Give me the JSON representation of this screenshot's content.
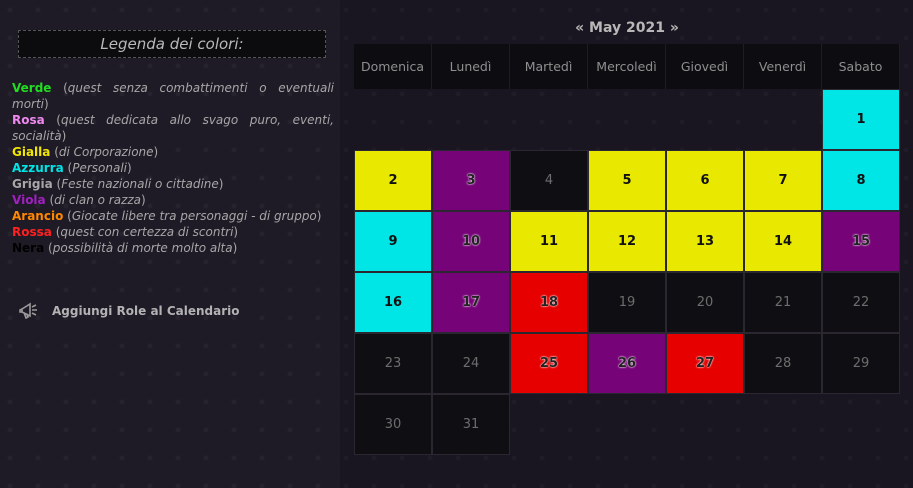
{
  "legend": {
    "title": "Legenda dei colori:",
    "items": [
      {
        "name": "Verde",
        "desc": "quest senza combattimenti o eventuali morti",
        "color": "#22dd22"
      },
      {
        "name": "Rosa",
        "desc": "quest dedicata allo svago puro, eventi, socialità",
        "color": "#ee88ee"
      },
      {
        "name": "Gialla",
        "desc": "di Corporazione",
        "color": "#f2e600"
      },
      {
        "name": "Azzurra",
        "desc": "Personali",
        "color": "#00e4e4"
      },
      {
        "name": "Grigia",
        "desc": "Feste nazionali o cittadine",
        "color": "#a7a7a7"
      },
      {
        "name": "Viola",
        "desc": "di clan o razza",
        "color": "#a020c0"
      },
      {
        "name": "Arancio",
        "desc": "Giocate libere tra personaggi - di gruppo",
        "color": "#ff8800"
      },
      {
        "name": "Rossa",
        "desc": "quest con certezza di scontri",
        "color": "#ff2020"
      },
      {
        "name": "Nera",
        "desc": "possibilità di morte molto alta",
        "color": "#000000"
      }
    ]
  },
  "add_role": {
    "label": "Aggiungi Role al Calendario",
    "icon": "megaphone-icon"
  },
  "calendar": {
    "prev": "«",
    "month_label": "May 2021",
    "next": "»",
    "weekdays": [
      "Domenica",
      "Lunedì",
      "Martedì",
      "Mercoledì",
      "Giovedì",
      "Venerdì",
      "Sabato"
    ],
    "weeks": [
      [
        {
          "day": "",
          "c": ""
        },
        {
          "day": "",
          "c": ""
        },
        {
          "day": "",
          "c": ""
        },
        {
          "day": "",
          "c": ""
        },
        {
          "day": "",
          "c": ""
        },
        {
          "day": "",
          "c": ""
        },
        {
          "day": "1",
          "c": "cyan"
        }
      ],
      [
        {
          "day": "2",
          "c": "yellow"
        },
        {
          "day": "3",
          "c": "purple"
        },
        {
          "day": "4",
          "c": "black"
        },
        {
          "day": "5",
          "c": "yellow"
        },
        {
          "day": "6",
          "c": "yellow"
        },
        {
          "day": "7",
          "c": "yellow"
        },
        {
          "day": "8",
          "c": "cyan"
        }
      ],
      [
        {
          "day": "9",
          "c": "cyan"
        },
        {
          "day": "10",
          "c": "purple"
        },
        {
          "day": "11",
          "c": "yellow"
        },
        {
          "day": "12",
          "c": "yellow"
        },
        {
          "day": "13",
          "c": "yellow"
        },
        {
          "day": "14",
          "c": "yellow"
        },
        {
          "day": "15",
          "c": "purple"
        }
      ],
      [
        {
          "day": "16",
          "c": "cyan"
        },
        {
          "day": "17",
          "c": "purple"
        },
        {
          "day": "18",
          "c": "red"
        },
        {
          "day": "19",
          "c": "black"
        },
        {
          "day": "20",
          "c": "black"
        },
        {
          "day": "21",
          "c": "black"
        },
        {
          "day": "22",
          "c": "black"
        }
      ],
      [
        {
          "day": "23",
          "c": "black"
        },
        {
          "day": "24",
          "c": "black"
        },
        {
          "day": "25",
          "c": "red"
        },
        {
          "day": "26",
          "c": "purple"
        },
        {
          "day": "27",
          "c": "red"
        },
        {
          "day": "28",
          "c": "black"
        },
        {
          "day": "29",
          "c": "black"
        }
      ],
      [
        {
          "day": "30",
          "c": "black"
        },
        {
          "day": "31",
          "c": "black"
        },
        {
          "day": "",
          "c": ""
        },
        {
          "day": "",
          "c": ""
        },
        {
          "day": "",
          "c": ""
        },
        {
          "day": "",
          "c": ""
        },
        {
          "day": "",
          "c": ""
        }
      ]
    ],
    "colors": {
      "cyan": "#00e6e6",
      "yellow": "#e8e800",
      "purple": "#760478",
      "red": "#e60000",
      "black": "#0f0e12"
    }
  }
}
